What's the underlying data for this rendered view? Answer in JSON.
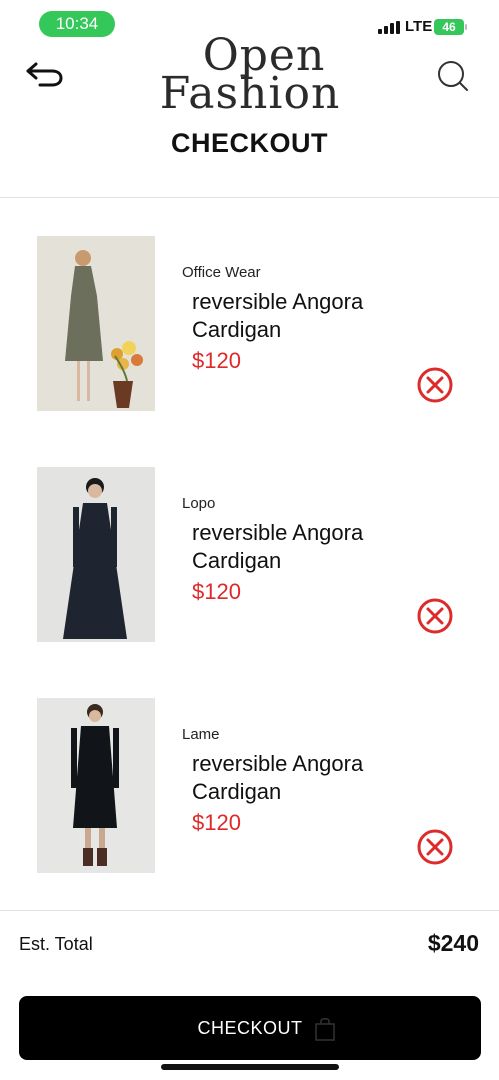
{
  "status_bar": {
    "time": "10:34",
    "network": "LTE",
    "battery": "46"
  },
  "header": {
    "logo_line1": "Open",
    "logo_line2": "Fashion",
    "title": "CHECKOUT"
  },
  "cart": {
    "items": [
      {
        "brand": "Office Wear",
        "name": "reversible Angora Cardigan",
        "price": "$120"
      },
      {
        "brand": "Lopo",
        "name": "reversible Angora Cardigan",
        "price": "$120"
      },
      {
        "brand": "Lame",
        "name": "reversible Angora Cardigan",
        "price": "$120"
      }
    ]
  },
  "summary": {
    "total_label": "Est. Total",
    "total_value": "$240"
  },
  "checkout_button": {
    "label": "CHECKOUT"
  },
  "colors": {
    "accent_red": "#dd2a2a",
    "status_green": "#34c759",
    "button_black": "#000000"
  },
  "icons": [
    "back-arrow-icon",
    "search-icon",
    "remove-circle-x-icon",
    "shopping-bag-icon"
  ]
}
